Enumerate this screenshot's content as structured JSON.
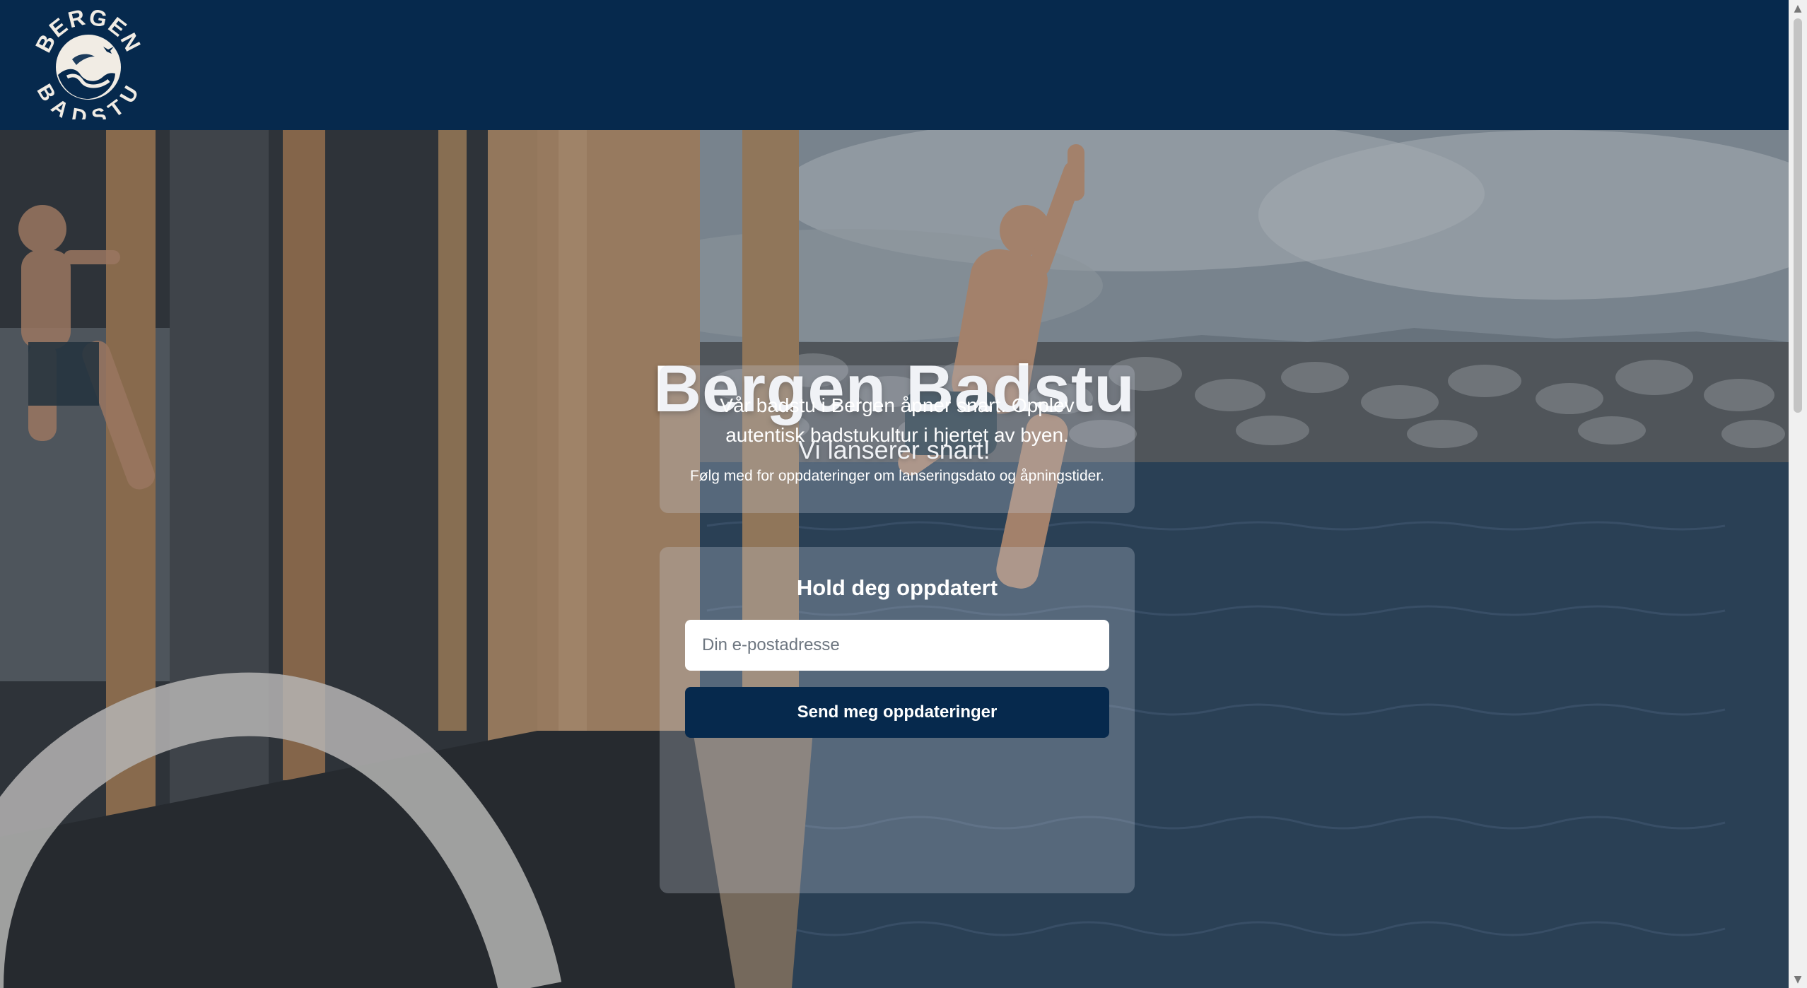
{
  "header": {
    "logo_text_top": "BERGEN",
    "logo_text_bottom": "BADSTU",
    "logo_alt": "Bergen Badstu logo"
  },
  "hero": {
    "title": "Bergen Badstu",
    "subtitle": "Vi lanserer snart!",
    "image_description_icon": "hero-photo"
  },
  "info_card": {
    "main_text": "Vår badstu i Bergen åpner snart. Opplev autentisk badstukultur i hjertet av byen.",
    "sub_text": "Følg med for oppdateringer om lanseringsdato og åpningstider."
  },
  "signup_card": {
    "heading": "Hold deg oppdatert",
    "email_placeholder": "Din e-postadresse",
    "email_value": "",
    "submit_label": "Send meg oppdateringer"
  },
  "colors": {
    "header_bg": "#06294d",
    "button_bg": "#06294d",
    "text": "#ffffff"
  },
  "scrollbar": {
    "up_icon": "scroll-up-arrow-icon",
    "down_icon": "scroll-down-arrow-icon"
  }
}
